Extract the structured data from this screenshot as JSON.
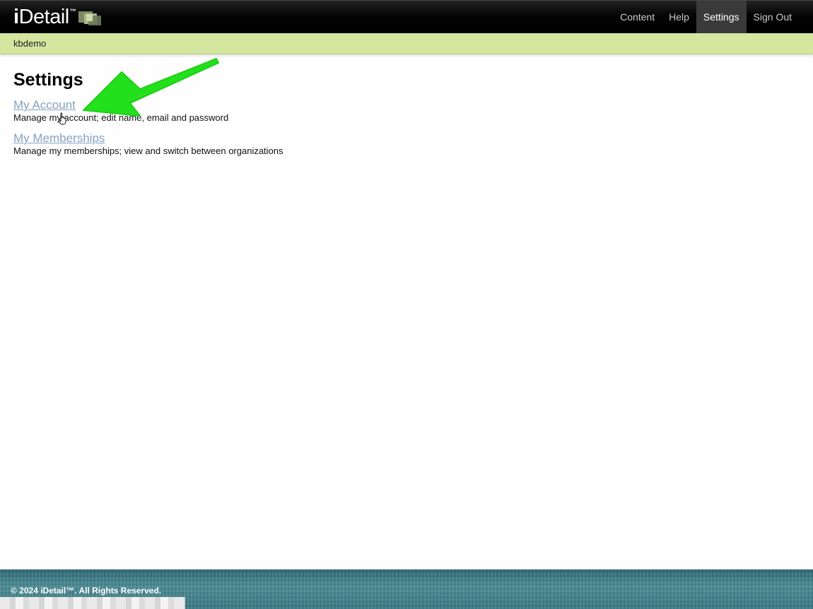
{
  "header": {
    "brand": {
      "prefix": "i",
      "name": "Detail",
      "trademark": "™"
    },
    "nav": [
      {
        "label": "Content",
        "active": false
      },
      {
        "label": "Help",
        "active": false
      },
      {
        "label": "Settings",
        "active": true
      },
      {
        "label": "Sign Out",
        "active": false
      }
    ]
  },
  "subbar": {
    "username": "kbdemo"
  },
  "main": {
    "title": "Settings",
    "entries": [
      {
        "link": "My Account",
        "description": "Manage my account; edit name, email and password"
      },
      {
        "link": "My Memberships",
        "description": "Manage my memberships; view and switch between organizations"
      }
    ]
  },
  "annotation": {
    "arrow_color": "#22e01b",
    "icon": "arrow-icon",
    "cursor_icon": "hand-pointer-icon"
  },
  "footer": {
    "copyright": "© 2024 iDetail™.  All Rights Reserved."
  },
  "colors": {
    "topbar": "#000000",
    "nav_active_bg": "#3a3a3a",
    "subbar_bg": "#d4e6a0",
    "link": "#86a3c2",
    "footer": "#3f7f8a"
  }
}
